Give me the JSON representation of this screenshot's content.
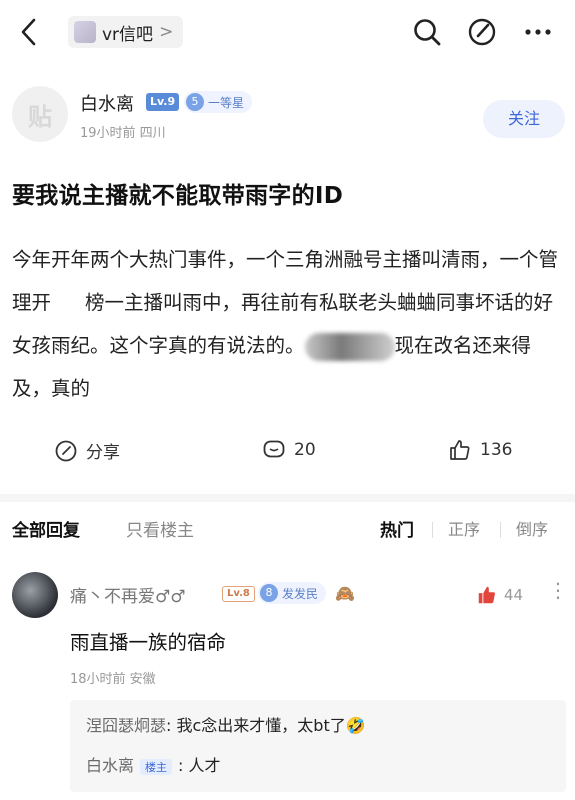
{
  "header": {
    "forum_name": "vr信吧",
    "forum_arrow": ">",
    "icons": [
      "back-icon",
      "search-icon",
      "edit-icon",
      "more-icon"
    ]
  },
  "author": {
    "avatar_text": "贴",
    "name": "白水离",
    "level": "Lv.9",
    "rank_num": "5",
    "rank_name": "一等星",
    "meta": "19小时前  四川",
    "follow_label": "关注"
  },
  "post": {
    "title": "要我说主播就不能取带雨字的ID",
    "body_part1": "今年开年两个大热门事件，一个三角洲融号主播叫清雨，一个管理开",
    "body_part2": "榜一主播叫雨中，再往前有私联老头蛐蛐同事坏话的好女孩雨纪。这个字真的有说法的。",
    "body_part3": "现在改名还来得及，真的"
  },
  "actions": {
    "share_label": "分享",
    "comment_count": "20",
    "like_count": "136"
  },
  "tabs": {
    "all_replies": "全部回复",
    "only_host": "只看楼主",
    "hot": "热门",
    "asc": "正序",
    "desc": "倒序"
  },
  "comment": {
    "name": "痛丶不再爱♂♂",
    "level": "Lv.8",
    "rank_num": "8",
    "rank_name": "发发民",
    "emoji": "🙈",
    "likes": "44",
    "more": "⋮",
    "text": "雨直播一族的宿命",
    "meta": "18小时前  安徽",
    "replies": [
      {
        "name": "涅囧瑟炯瑟",
        "text": "我c念出来才懂，太bt了🤣",
        "host": ""
      },
      {
        "name": "白水离",
        "text": "人才",
        "host": "楼主"
      }
    ]
  },
  "colors": {
    "accent": "#3e67d6",
    "like_red": "#e2453c",
    "muted": "#999999"
  }
}
